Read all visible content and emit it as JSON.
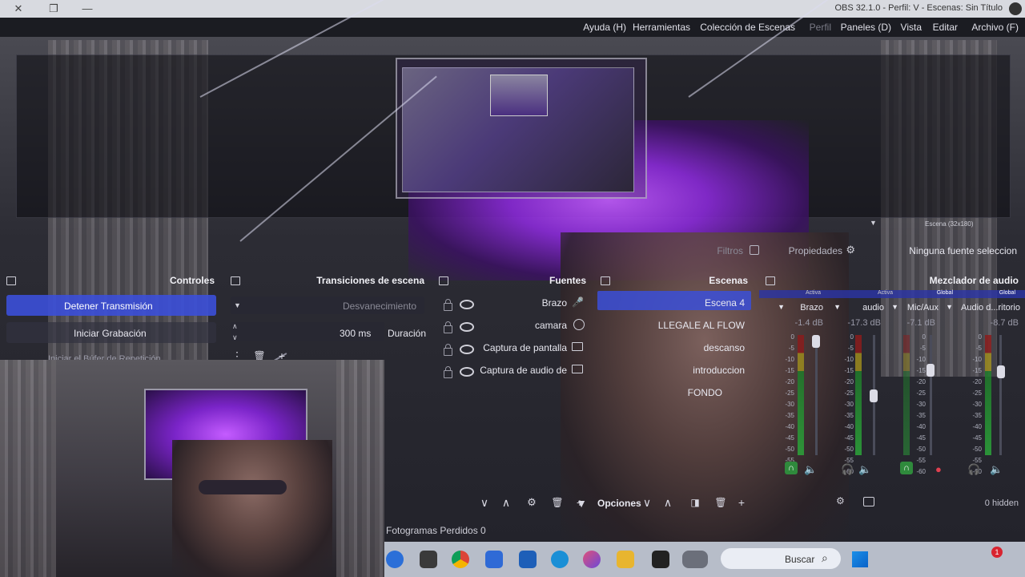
{
  "window": {
    "title": "OBS 32.1.0 - Perfil: V - Escenas: Sin Título"
  },
  "menu": {
    "items": [
      "Archivo (F)",
      "Editar",
      "Vista",
      "Paneles (D)",
      "Perfil",
      "Colección de Escenas",
      "Herramientas",
      "Ayuda (H)"
    ]
  },
  "preview": {
    "top_label": "Escena (32x180)"
  },
  "context_bar": {
    "no_source": "Ninguna fuente seleccion",
    "properties": "Propiedades",
    "filters": "Filtros"
  },
  "audio_mixer": {
    "title": "Mezclador de audio",
    "tabs": [
      "Global",
      "Global",
      "Activa",
      "Activa"
    ],
    "channels": [
      {
        "name": "Audio d...ritorio",
        "db": "-8.7 dB",
        "fader": 0.72
      },
      {
        "name": "Mic/Aux",
        "db": "-7.1 dB",
        "fader": 0.73
      },
      {
        "name": "audio",
        "db": "-17.3 dB",
        "fader": 0.49
      },
      {
        "name": "Brazo",
        "db": "-1.4 dB",
        "fader": 1.0
      }
    ],
    "scale": [
      "0",
      "-5",
      "-10",
      "-15",
      "-20",
      "-25",
      "-30",
      "-35",
      "-40",
      "-45",
      "-50",
      "-55",
      "-60"
    ],
    "hidden": "0 hidden",
    "options_label": "Opciones"
  },
  "scenes": {
    "title": "Escenas",
    "items": [
      "Escena 4",
      "LLEGALE AL FLOW",
      "descanso",
      "introduccion",
      "FONDO"
    ],
    "selected_index": 0
  },
  "sources": {
    "title": "Fuentes",
    "items": [
      {
        "name": "Brazo",
        "icon": "mic-icon"
      },
      {
        "name": "camara",
        "icon": "camera-icon"
      },
      {
        "name": "Captura de pantalla",
        "icon": "monitor-icon"
      },
      {
        "name": "Captura de audio de",
        "icon": "audio-capture-icon"
      }
    ]
  },
  "transitions": {
    "title": "Transiciones de escena",
    "selected": "Desvanecimiento",
    "duration_label": "Duración",
    "duration_value": "300 ms"
  },
  "controls": {
    "title": "Controles",
    "stop_stream": "Detener Transmisión",
    "start_recording": "Iniciar Grabación",
    "replay": "Iniciar el Búfer de Repetición"
  },
  "status": {
    "dropped_frames": "Fotogramas Perdidos 0"
  },
  "taskbar": {
    "search_placeholder": "Buscar",
    "notification_badge": "1"
  },
  "colors": {
    "accent": "#3b4fd8",
    "background": "#15161c",
    "purple_light": "#b14cff"
  }
}
